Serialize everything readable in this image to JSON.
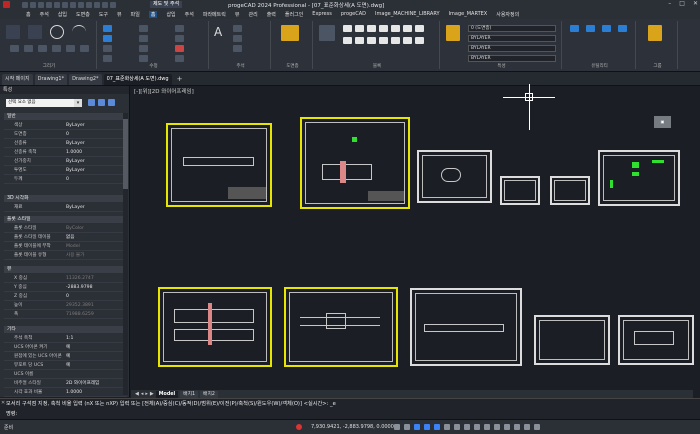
{
  "titlebar": {
    "workspace": "제도 및 주석",
    "title": "progeCAD 2024 Professional - [07_표준화상세(A 도면).dwg]"
  },
  "menubar": [
    "홈",
    "주석",
    "삽입",
    "도면층",
    "도구",
    "뷰",
    "파일",
    "홈",
    "삽입",
    "주석",
    "파라메트릭",
    "뷰",
    "관리",
    "출력",
    "플러그인",
    "Express",
    "progeCAD",
    "Image_MACHINE_LIBRARY",
    "Image_MARTEX",
    "사용자정의"
  ],
  "ribbon": {
    "groups": [
      "그리기",
      "수정",
      "주석",
      "도면층",
      "블록",
      "특성",
      "유틸리티",
      "그룹"
    ],
    "layer_dropdown": "0 (도면층)",
    "linetype_dropdown": "BYLAYER",
    "lineweight_dropdown": "BYLAYER",
    "color_dropdown": "BYLAYER"
  },
  "tabs": [
    "시작 페이지",
    "Drawing1*",
    "Drawing2*",
    "07_표준화상세(A 도면).dwg"
  ],
  "props": {
    "header": "특성",
    "selection": "선택 요소 없음",
    "sections": [
      {
        "title": "일반",
        "rows": [
          [
            "색상",
            "ByLayer",
            false
          ],
          [
            "도면층",
            "0",
            false
          ],
          [
            "선종류",
            "ByLayer",
            false
          ],
          [
            "선종류 축척",
            "1.0000",
            false
          ],
          [
            "선가중치",
            "ByLayer",
            false
          ],
          [
            "투명도",
            "ByLayer",
            false
          ],
          [
            "두께",
            "0",
            false
          ]
        ]
      },
      {
        "title": "3D 시각화",
        "rows": [
          [
            "재료",
            "ByLayer",
            false
          ]
        ]
      },
      {
        "title": "플롯 스타일",
        "rows": [
          [
            "플롯 스타일",
            "ByColor",
            true
          ],
          [
            "플롯 스타일 테이블",
            "없음",
            false
          ],
          [
            "플롯 테이블에 부착",
            "Model",
            true
          ],
          [
            "플롯 테이블 유형",
            "사용 불가",
            true
          ]
        ]
      },
      {
        "title": "뷰",
        "rows": [
          [
            "X 중심",
            "11326.2747",
            true
          ],
          [
            "Y 중심",
            "-2883.9798",
            false
          ],
          [
            "Z 중심",
            "0",
            false
          ],
          [
            "높이",
            "29352.3891",
            true
          ],
          [
            "폭",
            "71988.6259",
            true
          ]
        ]
      },
      {
        "title": "기타",
        "rows": [
          [
            "주석 축척",
            "1:1",
            false
          ],
          [
            "UCS 아이콘 켜기",
            "예",
            false
          ],
          [
            "원점에 있는 UCS 아이콘",
            "예",
            false
          ],
          [
            "뷰포트 당 UCS",
            "예",
            false
          ],
          [
            "UCS 이름",
            "",
            false
          ],
          [
            "비주얼 스타일",
            "2D 와이어프레임",
            false
          ],
          [
            "시각 효과 비율",
            "1.0000",
            false
          ]
        ]
      }
    ]
  },
  "viewlabel": "[-][위][2D 와이어프레임]",
  "layout_tabs": [
    "Model",
    "배치1",
    "배치2"
  ],
  "cmdline": {
    "history": "모서리 구석점 지정, 축척 비율 입력 (nX 또는 nXP) 입력 또는 [전체(A)/중심(C)/동적(D)/범위(E)/이전(P)/축척(S)/윈도우(W)/객체(O)] <실시간>: _e",
    "prompt": "명령:"
  },
  "status": {
    "state": "준비",
    "coords": "7,930.9421, -2,883.9798, 0.0000"
  },
  "colors": {
    "sheet_border": "#e6e600",
    "green": "#2fe02f",
    "accent": "#1e4f86"
  }
}
